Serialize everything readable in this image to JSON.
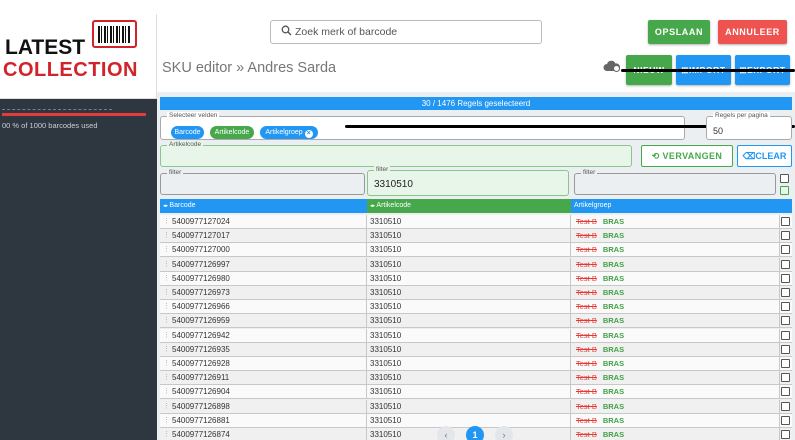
{
  "logo": {
    "line1": "LATEST",
    "line2": "COLLECTION"
  },
  "sidebar": {
    "usage": "00 % of 1000 barcodes used"
  },
  "header": {
    "search_placeholder": "Zoek merk of barcode",
    "save_label": "OPSLAAN",
    "cancel_label": "ANNULEER",
    "breadcrumb": "SKU editor  »  Andres Sarda",
    "new_label": "NIEUW",
    "import_label": "IMPORT",
    "export_label": "EXPORT"
  },
  "selection_info": "30 / 1476 Regels geselecteerd",
  "fields": {
    "legend": "Selecteer velden",
    "chips": [
      "Barcode",
      "Artikelcode",
      "Artikelgroep"
    ]
  },
  "per_page": {
    "legend": "Regels per pagina",
    "value": "50"
  },
  "replace": {
    "legend": "Artikelcode",
    "value": "",
    "replace_label": "VERVANGEN",
    "clear_label": "CLEAR"
  },
  "filters": [
    {
      "legend": "filter",
      "value": ""
    },
    {
      "legend": "filter",
      "value": "3310510"
    },
    {
      "legend": "filter",
      "value": ""
    }
  ],
  "table": {
    "columns": [
      "Barcode",
      "Artikelcode",
      "Artikelgroep"
    ],
    "rows": [
      {
        "barcode": "5400977127024",
        "artikelcode": "3310510",
        "old": "Test B",
        "new": "BRAS"
      },
      {
        "barcode": "5400977127017",
        "artikelcode": "3310510",
        "old": "Test B",
        "new": "BRAS"
      },
      {
        "barcode": "5400977127000",
        "artikelcode": "3310510",
        "old": "Test B",
        "new": "BRAS"
      },
      {
        "barcode": "5400977126997",
        "artikelcode": "3310510",
        "old": "Test B",
        "new": "BRAS"
      },
      {
        "barcode": "5400977126980",
        "artikelcode": "3310510",
        "old": "Test B",
        "new": "BRAS"
      },
      {
        "barcode": "5400977126973",
        "artikelcode": "3310510",
        "old": "Test B",
        "new": "BRAS"
      },
      {
        "barcode": "5400977126966",
        "artikelcode": "3310510",
        "old": "Test B",
        "new": "BRAS"
      },
      {
        "barcode": "5400977126959",
        "artikelcode": "3310510",
        "old": "Test B",
        "new": "BRAS"
      },
      {
        "barcode": "5400977126942",
        "artikelcode": "3310510",
        "old": "Test B",
        "new": "BRAS"
      },
      {
        "barcode": "5400977126935",
        "artikelcode": "3310510",
        "old": "Test B",
        "new": "BRAS"
      },
      {
        "barcode": "5400977126928",
        "artikelcode": "3310510",
        "old": "Test B",
        "new": "BRAS"
      },
      {
        "barcode": "5400977126911",
        "artikelcode": "3310510",
        "old": "Test B",
        "new": "BRAS"
      },
      {
        "barcode": "5400977126904",
        "artikelcode": "3310510",
        "old": "Test B",
        "new": "BRAS"
      },
      {
        "barcode": "5400977126898",
        "artikelcode": "3310510",
        "old": "Test B",
        "new": "BRAS"
      },
      {
        "barcode": "5400977126881",
        "artikelcode": "3310510",
        "old": "Test B",
        "new": "BRAS"
      },
      {
        "barcode": "5400977126874",
        "artikelcode": "3310510",
        "old": "Test B",
        "new": "BRAS"
      }
    ]
  },
  "pagination": {
    "prev": "‹",
    "current": "1",
    "next": "›"
  },
  "colors": {
    "green": "#46a84a",
    "blue": "#2196f3",
    "red": "#ef5350",
    "sidebar": "#2e3640"
  }
}
